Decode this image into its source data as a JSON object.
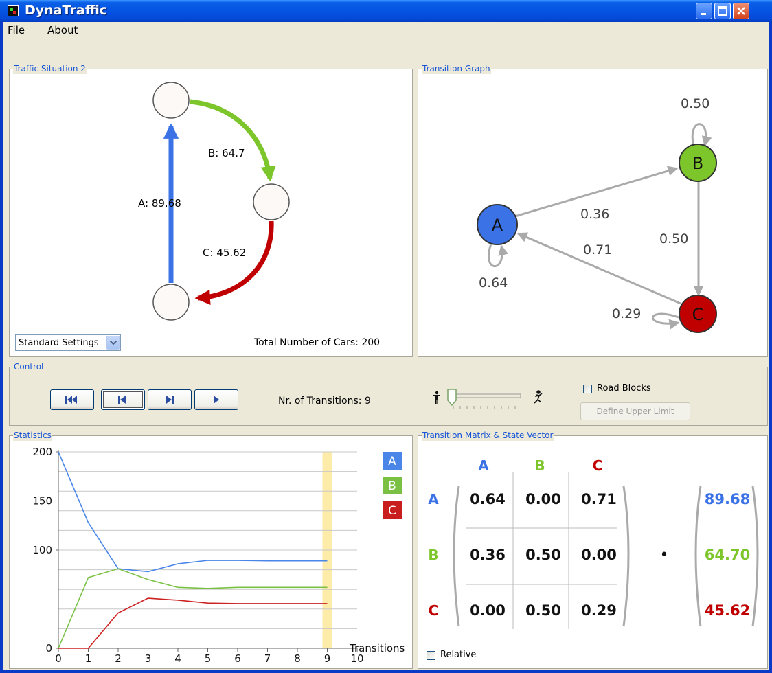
{
  "window": {
    "title": "DynaTraffic",
    "controls": [
      "minimize-icon",
      "maximize-icon",
      "close-icon"
    ]
  },
  "menu": {
    "file": "File",
    "about": "About"
  },
  "traffic_panel": {
    "title": "Traffic Situation 2",
    "edge_a": "A: 89.68",
    "edge_b": "B: 64.7",
    "edge_c": "C: 45.62",
    "settings_select": "Standard Settings",
    "total_cars": "Total Number of Cars: 200",
    "colors": {
      "A": "#3b73e6",
      "B": "#7cc52a",
      "C": "#c00000"
    }
  },
  "graph_panel": {
    "title": "Transition Graph",
    "nodes": [
      "A",
      "B",
      "C"
    ],
    "edges": [
      {
        "from": "A",
        "to": "A",
        "label": "0.64"
      },
      {
        "from": "A",
        "to": "B",
        "label": "0.36"
      },
      {
        "from": "B",
        "to": "B",
        "label": "0.50"
      },
      {
        "from": "B",
        "to": "C",
        "label": "0.50"
      },
      {
        "from": "C",
        "to": "A",
        "label": "0.71"
      },
      {
        "from": "C",
        "to": "C",
        "label": "0.29"
      }
    ]
  },
  "control_panel": {
    "title": "Control",
    "buttons": [
      "rewind-to-start",
      "step-back",
      "step-forward",
      "play"
    ],
    "transitions": "Nr. of Transitions: 9",
    "road_blocks": "Road Blocks",
    "road_blocks_checked": false,
    "define_limit": "Define Upper Limit"
  },
  "statistics_panel": {
    "title": "Statistics",
    "legend": [
      "A",
      "B",
      "C"
    ]
  },
  "matrix_panel": {
    "title": "Transition Matrix & State Vector",
    "columns": [
      "A",
      "B",
      "C"
    ],
    "rows": [
      "A",
      "B",
      "C"
    ],
    "matrix": [
      [
        "0.64",
        "0.00",
        "0.71"
      ],
      [
        "0.36",
        "0.50",
        "0.00"
      ],
      [
        "0.00",
        "0.50",
        "0.29"
      ]
    ],
    "dot": "•",
    "vector": [
      "89.68",
      "64.70",
      "45.62"
    ],
    "relative": "Relative",
    "relative_checked": false
  },
  "chart_data": {
    "type": "line",
    "xlabel": "Transitions",
    "ylabel": "",
    "x": [
      0,
      1,
      2,
      3,
      4,
      5,
      6,
      7,
      8,
      9
    ],
    "xlim": [
      0,
      10
    ],
    "ylim": [
      0,
      200
    ],
    "xticks": [
      "0",
      "1",
      "2",
      "3",
      "4",
      "5",
      "6",
      "7",
      "8",
      "9",
      "10"
    ],
    "yticks": [
      "0",
      "100",
      "150",
      "200"
    ],
    "highlight_x": 9,
    "grid": true,
    "legend_position": "top-right",
    "series": [
      {
        "name": "A",
        "color": "#4a86e8",
        "values": [
          200,
          128,
          81,
          78,
          86,
          89.5,
          89.5,
          89,
          89,
          89
        ]
      },
      {
        "name": "B",
        "color": "#7ac143",
        "values": [
          0,
          72,
          81,
          70,
          62,
          61,
          62,
          62,
          62,
          62
        ]
      },
      {
        "name": "C",
        "color": "#cc2222",
        "values": [
          0,
          0,
          36,
          51,
          49,
          46,
          45.5,
          45.5,
          45.5,
          45.5
        ]
      }
    ]
  }
}
